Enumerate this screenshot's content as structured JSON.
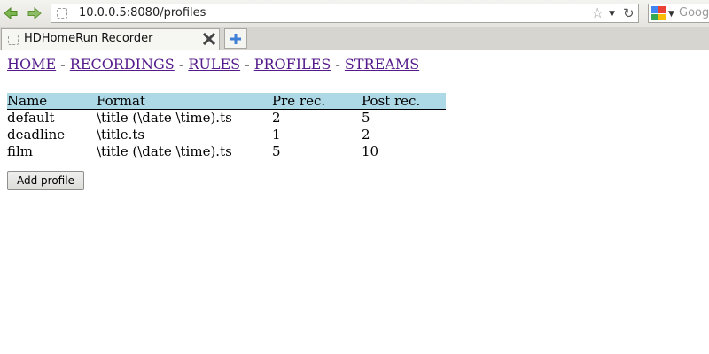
{
  "browser": {
    "url": "10.0.0.5:8080/profiles",
    "search_placeholder": "Goog",
    "tab_title": "HDHomeRun Recorder",
    "icons": {
      "back": "back-arrow-icon",
      "forward": "forward-arrow-icon",
      "bookmark": "star-icon",
      "reload": "reload-icon",
      "new_tab": "plus-icon",
      "close_tab": "close-icon"
    }
  },
  "nav": {
    "links": [
      "HOME",
      "RECORDINGS",
      "RULES",
      "PROFILES",
      "STREAMS"
    ],
    "separator": " - "
  },
  "profiles_table": {
    "headers": [
      "Name",
      "Format",
      "Pre rec.",
      "Post rec."
    ],
    "rows": [
      [
        "default",
        "\\title (\\date \\time).ts",
        "2",
        "5"
      ],
      [
        "deadline",
        "\\title.ts",
        "1",
        "2"
      ],
      [
        "film",
        "\\title (\\date \\time).ts",
        "5",
        "10"
      ]
    ],
    "header_color": "#add8e6"
  },
  "add_button_label": "Add profile",
  "colors": {
    "link": "#551a8b",
    "toolbar_arrow": "#5a9e2c",
    "new_tab_plus": "#3f7fd6"
  }
}
